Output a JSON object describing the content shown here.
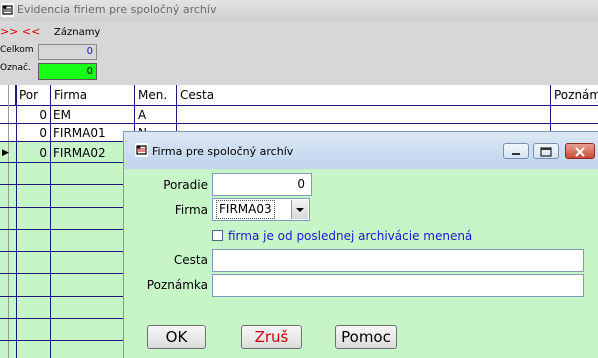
{
  "window": {
    "title": "Evidencia firiem pre spoločný archív"
  },
  "panel": {
    "nav_arrows": ">> <<",
    "section_label": "Záznamy",
    "celkom_label": "Celkom",
    "celkom_value": "0",
    "oznac_label": "Označ.",
    "oznac_value": "0",
    "oznac_color": "#16ff16"
  },
  "grid": {
    "columns": [
      "Por",
      "Firma",
      "Men.",
      "Cesta",
      "Poznám"
    ],
    "rows": [
      {
        "por": "0",
        "firma": "EM",
        "men": "A"
      },
      {
        "por": "0",
        "firma": "FIRMA01",
        "men": "N"
      },
      {
        "por": "0",
        "firma": "FIRMA02",
        "men": ""
      }
    ],
    "row_marker": "▶",
    "row_bg": "#c8f5c8"
  },
  "dialog": {
    "title": "Firma pre spoločný archív",
    "poradie_label": "Poradie",
    "poradie_value": "0",
    "firma_label": "Firma",
    "firma_value": "FIRMA03",
    "checkbox_label": "firma je od poslednej archivácie menená",
    "checkbox_checked": false,
    "cesta_label": "Cesta",
    "cesta_value": "",
    "poznamka_label": "Poznámka",
    "poznamka_value": "",
    "ok_label": "OK",
    "cancel_label": "Zruš",
    "help_label": "Pomoc",
    "cancel_color": "#cc0000"
  }
}
